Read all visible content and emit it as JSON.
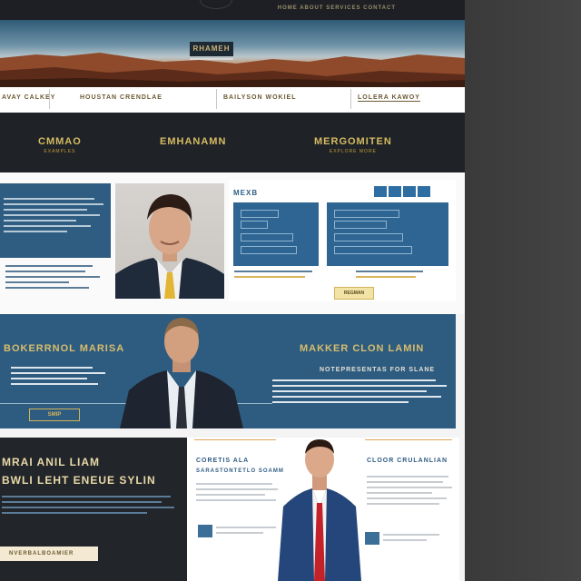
{
  "topbar": {
    "nav_text": "HOME  ABOUT  SERVICES  CONTACT"
  },
  "hero": {
    "title": "RHAMEH"
  },
  "navstrip": {
    "items": [
      "AVAY CALKEY",
      "HOUSTAN CRENDLAE",
      "BAILYSON WOKIEL",
      "LOLERA KAWOY"
    ]
  },
  "band": {
    "items": [
      {
        "title": "CMMAO",
        "sub": "EXAMPLES"
      },
      {
        "title": "EMHANAMN",
        "sub": ""
      },
      {
        "title": "MERGOMITEN",
        "sub": "EXPLORE MORE"
      }
    ]
  },
  "section2": {
    "panel_head": "MEXB",
    "chip_label": "REGMAN"
  },
  "bigband": {
    "title_left": "BOKERRNOL MARISA",
    "title_right": "MAKKER CLON LAMIN",
    "sub_right": "NOTEPRESENTAS FOR SLANE",
    "button_label": "SMIP"
  },
  "bottom": {
    "title1": "MRAI ANIL LIAM",
    "title2": "BWLI LEHT ENEUE SYLIN",
    "button_label": "NVERBALBOAMIER",
    "mid_title": "CORETIS ALA",
    "mid_sub": "SARASTONTETLO SOAMM",
    "right_title": "CLOOR CRULANLIAN"
  },
  "colors": {
    "navy": "#1f2327",
    "blue": "#2e5c80",
    "gold": "#d6bb62",
    "page": "#f4f4f4"
  }
}
